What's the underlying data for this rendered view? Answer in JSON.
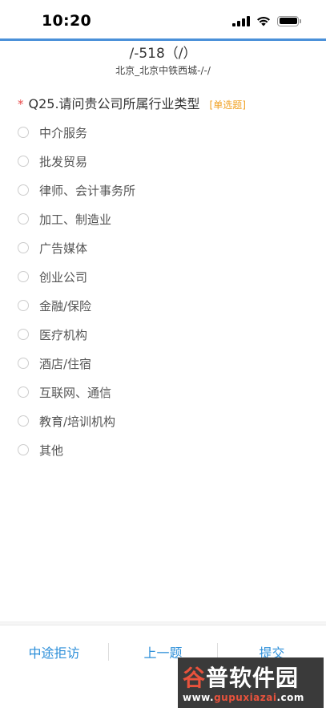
{
  "status_bar": {
    "time": "10:20"
  },
  "header": {
    "title": "/-518（/）",
    "subtitle": "北京_北京中铁西城-/-/"
  },
  "question": {
    "required_mark": "*",
    "text": "Q25.请问贵公司所属行业类型",
    "type_label": "[单选题]",
    "options": [
      {
        "label": "中介服务"
      },
      {
        "label": "批发贸易"
      },
      {
        "label": "律师、会计事务所"
      },
      {
        "label": "加工、制造业"
      },
      {
        "label": "广告媒体"
      },
      {
        "label": "创业公司"
      },
      {
        "label": "金融/保险"
      },
      {
        "label": "医疗机构"
      },
      {
        "label": "酒店/住宿"
      },
      {
        "label": "互联网、通信"
      },
      {
        "label": "教育/培训机构"
      },
      {
        "label": "其他"
      }
    ]
  },
  "footer": {
    "refuse_label": "中途拒访",
    "prev_label": "上一题",
    "submit_label": "提交"
  },
  "watermark": {
    "logo_part1": "谷",
    "logo_part2": "普软件园",
    "url_part1": "www.",
    "url_part2": "gupuxiazai",
    "url_part3": ".com"
  },
  "colors": {
    "accent": "#2d8fd9",
    "top_line": "#4a90d9",
    "required": "#e84a4a",
    "type_label": "#f0a020"
  },
  "icons": [
    "signal-icon",
    "wifi-icon",
    "battery-icon"
  ]
}
